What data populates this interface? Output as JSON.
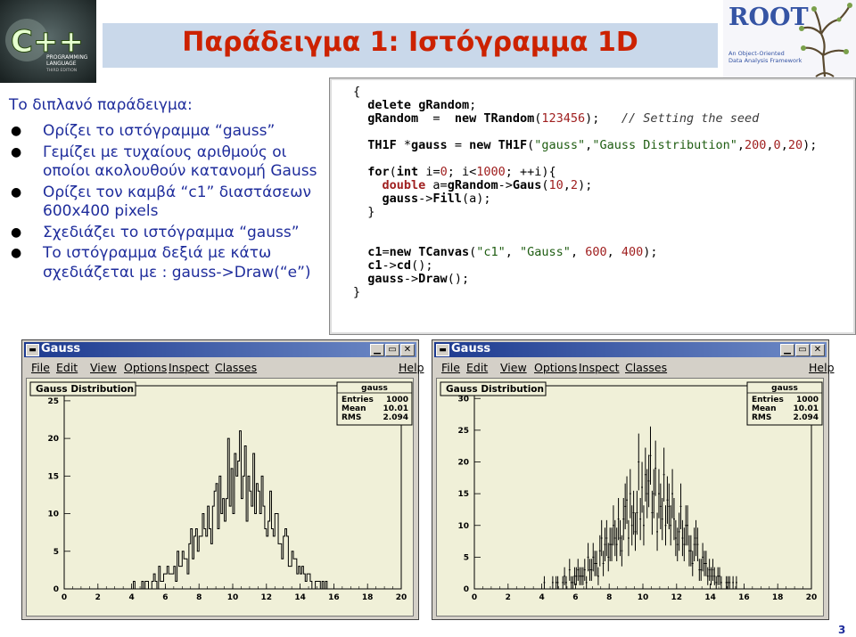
{
  "slide": {
    "title": "Παράδειγμα 1: Ιστόγραμμα 1D",
    "page_number": "3",
    "intro": "Το διπλανό παράδειγμα:",
    "bullets": [
      [
        "Ορίζει το ιστόγραμμα “gauss”"
      ],
      [
        "Γεμίζει με τυχαίους αριθμούς οι",
        "οποίοι ακολουθούν κατανομή Gauss"
      ],
      [
        "Ορίζει τον καμβά “c1” διαστάσεων",
        "600x400 pixels"
      ],
      [
        "Σχεδιάζει το ιστόγραμμα “gauss”"
      ],
      [
        "Το ιστόγραμμα δεξιά με κάτω",
        "σχεδιάζεται με : gauss->Draw(“e”)"
      ]
    ],
    "colors": {
      "title": "#cc2200",
      "text": "#1f2d9c",
      "banner": "#c9d8ea"
    }
  },
  "logos": {
    "cpp": {
      "letters": "C++",
      "sub": [
        "PROGRAMMING",
        "LANGUAGE",
        "THIRD EDITION"
      ]
    },
    "root": {
      "word": "ROOT",
      "sub": [
        "An Object-Oriented",
        "Data Analysis Framework"
      ]
    }
  },
  "code": {
    "lines": [
      "{",
      "  delete gRandom;",
      "  gRandom  =  new TRandom(123456);   // Setting the seed",
      "",
      "  TH1F *gauss = new TH1F(\"gauss\",\"Gauss Distribution\",200,0,20);",
      "",
      "  for(int i=0; i<1000; ++i){",
      "    double a=gRandom->Gaus(10,2);",
      "    gauss->Fill(a);",
      "  }",
      "",
      "",
      "  c1=new TCanvas(\"c1\", \"Gauss\", 600, 400);",
      "  c1->cd();",
      "  gauss->Draw();",
      "}"
    ]
  },
  "windows": [
    {
      "title": "Gauss",
      "sys_icon": "window-menu-icon",
      "menu": [
        "File",
        "Edit",
        "View",
        "Options",
        "Inspect",
        "Classes",
        "Help"
      ],
      "buttons": [
        "minimize-icon",
        "maximize-icon",
        "close-icon"
      ],
      "hist_title": "Gauss Distribution",
      "stats": {
        "name": "gauss",
        "rows": [
          [
            "Entries",
            "1000"
          ],
          [
            "Mean",
            "10.01"
          ],
          [
            "RMS",
            "2.094"
          ]
        ]
      },
      "style": "histogram-outline"
    },
    {
      "title": "Gauss",
      "sys_icon": "window-menu-icon",
      "menu": [
        "File",
        "Edit",
        "View",
        "Options",
        "Inspect",
        "Classes",
        "Help"
      ],
      "buttons": [
        "minimize-icon",
        "maximize-icon",
        "close-icon"
      ],
      "hist_title": "Gauss Distribution",
      "stats": {
        "name": "gauss",
        "rows": [
          [
            "Entries",
            "1000"
          ],
          [
            "Mean",
            "10.01"
          ],
          [
            "RMS",
            "2.094"
          ]
        ]
      },
      "style": "error-bars"
    }
  ],
  "chart_data": [
    {
      "type": "bar",
      "title": "Gauss Distribution",
      "xlim": [
        0,
        20
      ],
      "ylim": [
        0,
        27
      ],
      "x_ticks": [
        0,
        2,
        4,
        6,
        8,
        10,
        12,
        14,
        16,
        18,
        20
      ],
      "y_ticks": [
        0,
        5,
        10,
        15,
        20,
        25
      ],
      "bins": 200,
      "mean": 10.01,
      "rms": 2.094,
      "entries": 1000,
      "values": [
        0,
        0,
        0,
        0,
        0,
        0,
        0,
        0,
        0,
        0,
        0,
        0,
        0,
        0,
        0,
        0,
        0,
        0,
        0,
        0,
        0,
        0,
        0,
        0,
        0,
        0,
        0,
        0,
        0,
        0,
        0,
        0,
        0,
        0,
        0,
        0,
        0,
        0,
        0,
        0,
        0,
        1,
        0,
        0,
        0,
        0,
        1,
        0,
        1,
        1,
        0,
        0,
        1,
        2,
        1,
        0,
        3,
        1,
        1,
        2,
        2,
        3,
        2,
        2,
        2,
        3,
        1,
        5,
        3,
        3,
        5,
        4,
        4,
        2,
        6,
        8,
        4,
        7,
        8,
        5,
        7,
        7,
        10,
        8,
        7,
        11,
        8,
        6,
        11,
        13,
        14,
        8,
        15,
        10,
        12,
        9,
        12,
        20,
        11,
        16,
        10,
        18,
        15,
        17,
        21,
        12,
        15,
        19,
        9,
        15,
        13,
        11,
        18,
        10,
        14,
        13,
        10,
        15,
        11,
        8,
        7,
        9,
        13,
        8,
        7,
        10,
        10,
        6,
        6,
        4,
        7,
        8,
        7,
        3,
        3,
        5,
        4,
        4,
        2,
        3,
        2,
        3,
        2,
        1,
        2,
        2,
        1,
        0,
        0,
        1,
        1,
        1,
        0,
        1,
        0,
        1,
        0,
        0,
        0,
        0,
        0,
        0,
        0,
        0,
        0,
        0,
        0,
        0,
        0,
        0,
        0,
        0,
        0,
        0,
        0,
        0,
        0,
        0,
        0,
        0,
        0,
        0,
        0,
        0,
        0,
        0,
        0,
        0,
        0,
        0,
        0,
        0,
        0,
        0,
        0,
        0,
        0,
        0,
        0,
        0
      ]
    },
    {
      "type": "scatter",
      "title": "Gauss Distribution",
      "xlim": [
        0,
        20
      ],
      "ylim": [
        0,
        32
      ],
      "x_ticks": [
        0,
        2,
        4,
        6,
        8,
        10,
        12,
        14,
        16,
        18,
        20
      ],
      "y_ticks": [
        0,
        5,
        10,
        15,
        20,
        25,
        30
      ],
      "bins": 200,
      "mean": 10.01,
      "rms": 2.094,
      "entries": 1000,
      "error_bars": true,
      "values": [
        0,
        0,
        0,
        0,
        0,
        0,
        0,
        0,
        0,
        0,
        0,
        0,
        0,
        0,
        0,
        0,
        0,
        0,
        0,
        0,
        0,
        0,
        0,
        0,
        0,
        0,
        0,
        0,
        0,
        0,
        0,
        0,
        0,
        0,
        0,
        0,
        0,
        0,
        0,
        0,
        0,
        1,
        0,
        0,
        0,
        0,
        1,
        0,
        1,
        1,
        0,
        0,
        1,
        2,
        1,
        0,
        3,
        1,
        1,
        2,
        2,
        3,
        2,
        2,
        2,
        3,
        1,
        5,
        3,
        3,
        5,
        4,
        4,
        2,
        6,
        8,
        4,
        7,
        8,
        5,
        7,
        7,
        10,
        8,
        7,
        11,
        8,
        6,
        11,
        13,
        14,
        8,
        15,
        10,
        12,
        9,
        12,
        20,
        11,
        16,
        10,
        18,
        15,
        17,
        21,
        12,
        15,
        19,
        9,
        15,
        13,
        11,
        18,
        10,
        14,
        13,
        10,
        15,
        11,
        8,
        7,
        9,
        13,
        8,
        7,
        10,
        10,
        6,
        6,
        4,
        7,
        8,
        7,
        3,
        3,
        5,
        4,
        4,
        2,
        3,
        2,
        3,
        2,
        1,
        2,
        2,
        1,
        0,
        0,
        1,
        1,
        1,
        0,
        1,
        0,
        1,
        0,
        0,
        0,
        0,
        0,
        0,
        0,
        0,
        0,
        0,
        0,
        0,
        0,
        0,
        0,
        0,
        0,
        0,
        0,
        0,
        0,
        0,
        0,
        0,
        0,
        0,
        0,
        0,
        0,
        0,
        0,
        0,
        0,
        0,
        0,
        0,
        0,
        0,
        0,
        0,
        0,
        0,
        0,
        0
      ]
    }
  ]
}
